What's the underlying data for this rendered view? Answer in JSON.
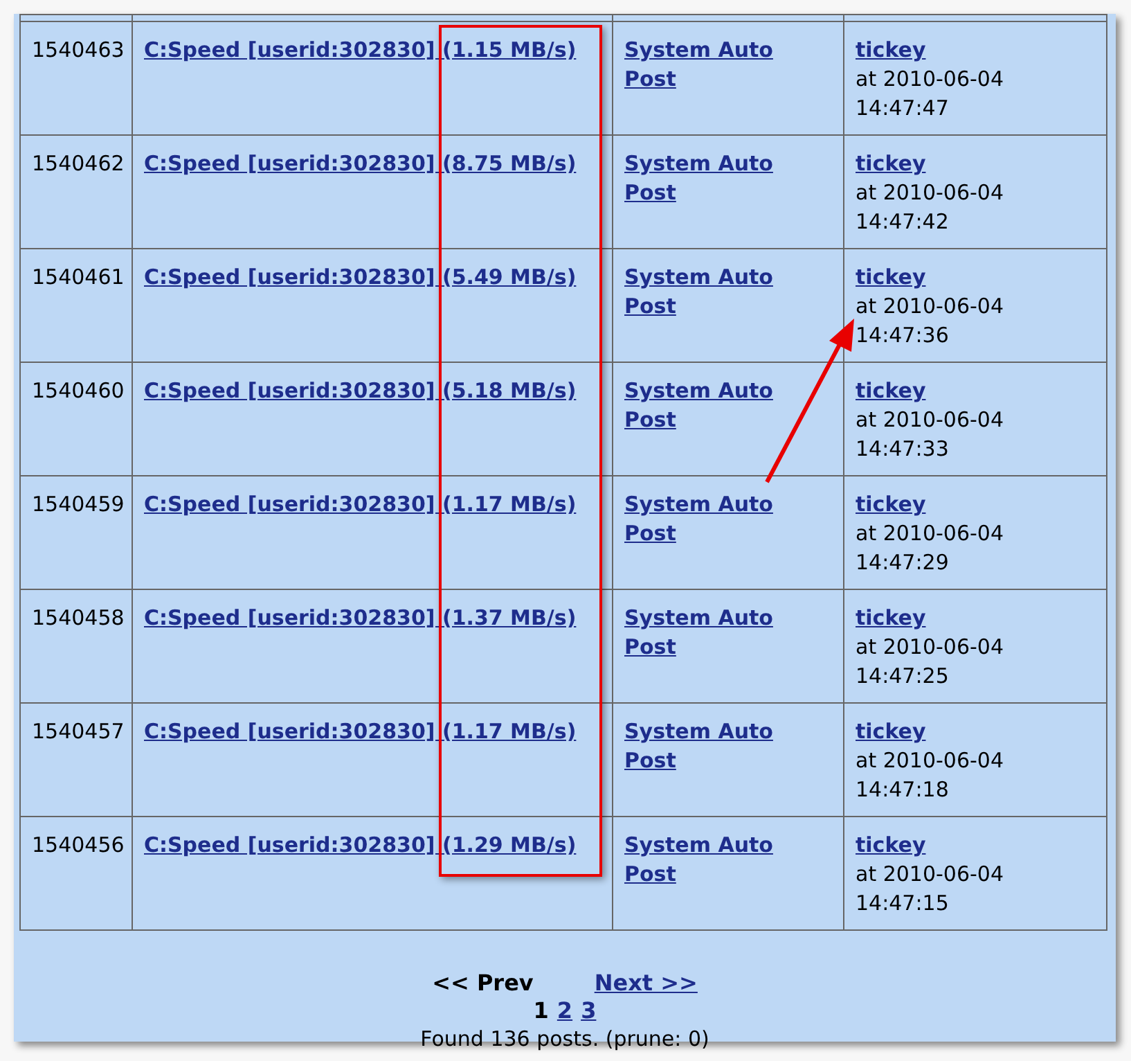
{
  "posts": [
    {
      "id": "1540463",
      "subject": "C:Speed [userid:302830] (1.15 MB/s)",
      "poster": "System Auto Post",
      "user": "tickey",
      "date": "at 2010-06-04",
      "time": "14:47:47"
    },
    {
      "id": "1540462",
      "subject": "C:Speed [userid:302830] (8.75 MB/s)",
      "poster": "System Auto Post",
      "user": "tickey",
      "date": "at 2010-06-04",
      "time": "14:47:42"
    },
    {
      "id": "1540461",
      "subject": "C:Speed [userid:302830] (5.49 MB/s)",
      "poster": "System Auto Post",
      "user": "tickey",
      "date": "at 2010-06-04",
      "time": "14:47:36"
    },
    {
      "id": "1540460",
      "subject": "C:Speed [userid:302830] (5.18 MB/s)",
      "poster": "System Auto Post",
      "user": "tickey",
      "date": "at 2010-06-04",
      "time": "14:47:33"
    },
    {
      "id": "1540459",
      "subject": "C:Speed [userid:302830] (1.17 MB/s)",
      "poster": "System Auto Post",
      "user": "tickey",
      "date": "at 2010-06-04",
      "time": "14:47:29"
    },
    {
      "id": "1540458",
      "subject": "C:Speed [userid:302830] (1.37 MB/s)",
      "poster": "System Auto Post",
      "user": "tickey",
      "date": "at 2010-06-04",
      "time": "14:47:25"
    },
    {
      "id": "1540457",
      "subject": "C:Speed [userid:302830] (1.17 MB/s)",
      "poster": "System Auto Post",
      "user": "tickey",
      "date": "at 2010-06-04",
      "time": "14:47:18"
    },
    {
      "id": "1540456",
      "subject": "C:Speed [userid:302830] (1.29 MB/s)",
      "poster": "System Auto Post",
      "user": "tickey",
      "date": "at 2010-06-04",
      "time": "14:47:15"
    }
  ],
  "pager": {
    "prev": {
      "label": "<< Prev",
      "link": false
    },
    "next": {
      "label": "Next >>",
      "link": true
    },
    "pages": [
      {
        "label": "1",
        "selected": true
      },
      {
        "label": "2",
        "selected": false
      },
      {
        "label": "3",
        "selected": false
      }
    ],
    "summary": "Found 136 posts. (prune: 0)"
  }
}
